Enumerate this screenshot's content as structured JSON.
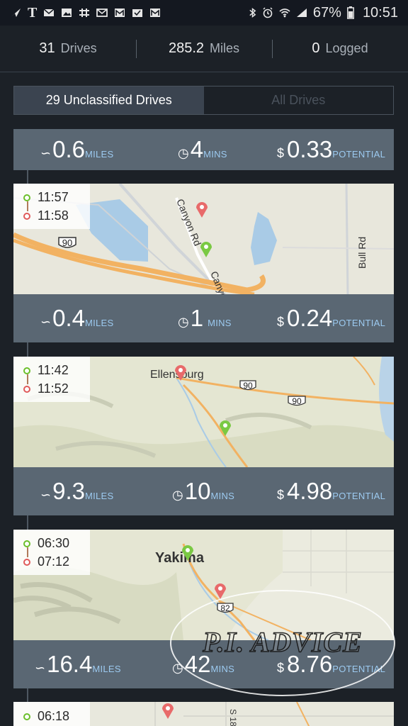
{
  "status_bar": {
    "battery": "67%",
    "time": "10:51"
  },
  "summary": {
    "drives_count": "31",
    "drives_label": "Drives",
    "miles_value": "285.2",
    "miles_label": "Miles",
    "logged_count": "0",
    "logged_label": "Logged"
  },
  "tabs": {
    "unclassified": "29 Unclassified Drives",
    "all": "All Drives"
  },
  "top_stats": {
    "miles": "0.6",
    "mins": "4",
    "potential": "0.33"
  },
  "units": {
    "miles": "MILES",
    "mins": "MINS",
    "potential": "POTENTIAL",
    "currency": "$"
  },
  "drives": [
    {
      "start": "11:57",
      "end": "11:58",
      "miles": "0.4",
      "mins": "1",
      "potential": "0.24",
      "map_labels": {
        "road": "Canyon Rd",
        "road2": "Canyon",
        "road3": "Bull Rd",
        "shield": "90"
      }
    },
    {
      "start": "11:42",
      "end": "11:52",
      "miles": "9.3",
      "mins": "10",
      "potential": "4.98",
      "map_labels": {
        "city": "Ellensburg",
        "shield_a": "90",
        "shield_b": "90"
      }
    },
    {
      "start": "06:30",
      "end": "07:12",
      "miles": "16.4",
      "mins": "42",
      "potential": "8.76",
      "map_labels": {
        "city": "Yakima",
        "shield": "82"
      }
    },
    {
      "start": "06:18",
      "map_labels": {
        "road": "S 18"
      }
    }
  ],
  "watermark": "P.I. ADVICE",
  "colors": {
    "background": "#1c2127",
    "stats_bar": "#5a6773",
    "unit_text": "#9ccaf0",
    "start_pin": "#7ac943",
    "end_pin": "#e86a6a"
  }
}
